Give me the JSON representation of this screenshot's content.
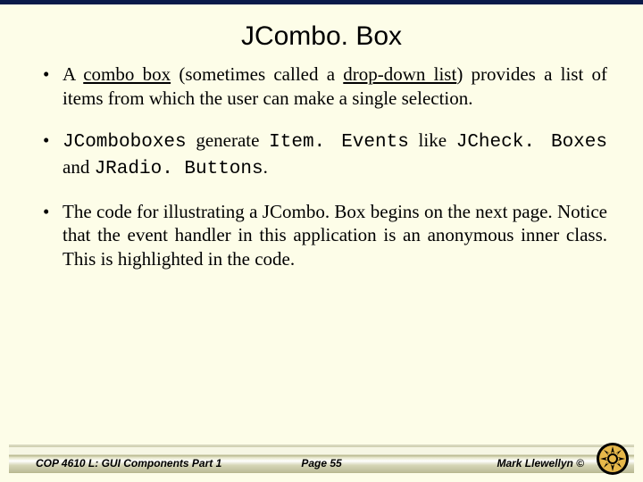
{
  "title": "JCombo. Box",
  "bullets": {
    "b1": {
      "pre": "A ",
      "u1": "combo box",
      "mid": " (sometimes called a ",
      "u2": "drop-down list",
      "post": ") provides a list of items from which the user can make a single selection."
    },
    "b2": {
      "c1": "JComboboxes",
      "t1": " generate ",
      "c2": "Item. Events",
      "t2": " like ",
      "c3": "JCheck. Boxes",
      "t3": " and ",
      "c4": "JRadio. Buttons",
      "t4": "."
    },
    "b3": "The code for illustrating a JCombo. Box begins on the next page.  Notice that the event handler in this application is an anonymous inner class.  This is highlighted in the code."
  },
  "footer": {
    "left": "COP 4610 L: GUI Components Part 1",
    "center": "Page 55",
    "right": "Mark Llewellyn ©"
  }
}
